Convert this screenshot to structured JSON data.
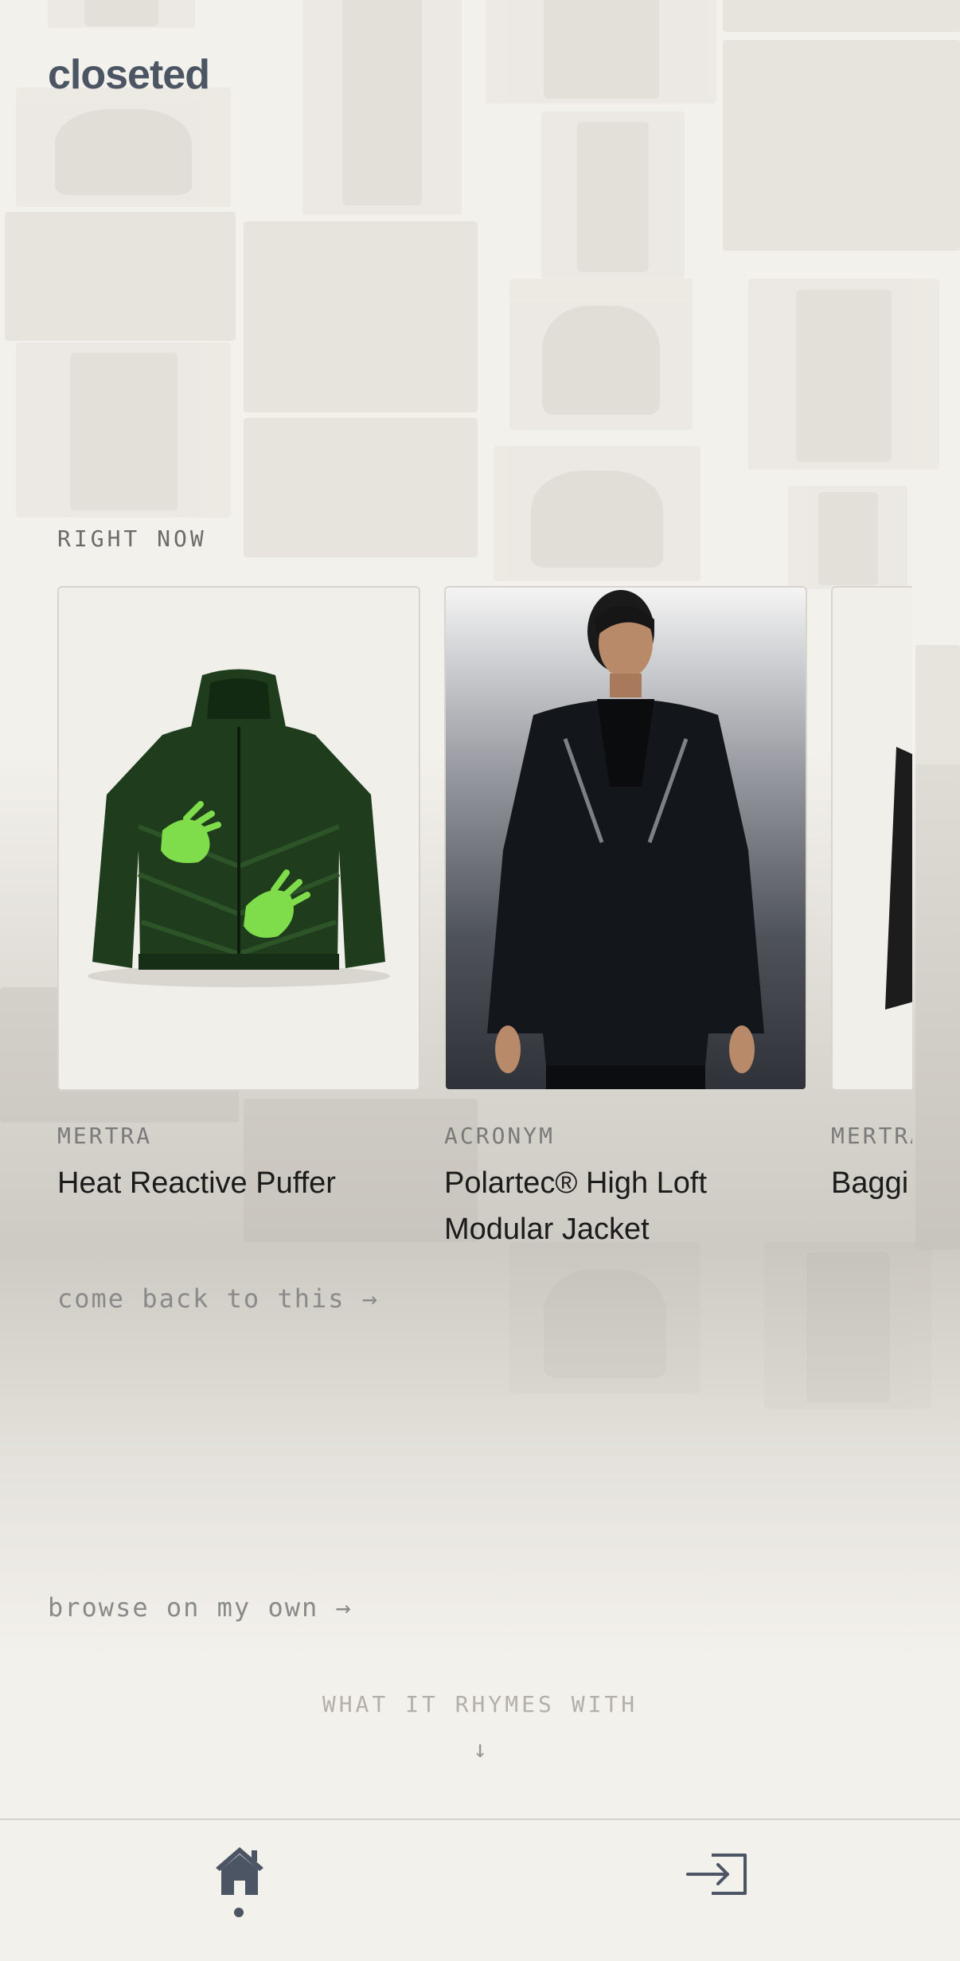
{
  "app": {
    "logo": "closeted"
  },
  "right_now": {
    "label": "RIGHT NOW",
    "items": [
      {
        "brand": "MERTRA",
        "name": "Heat Reactive Puffer"
      },
      {
        "brand": "ACRONYM",
        "name": "Polartec® High Loft Modular Jacket"
      },
      {
        "brand": "MERTRA",
        "name": "Baggi"
      }
    ],
    "come_back": "come back to this →"
  },
  "browse": {
    "label": "browse on my own →"
  },
  "rhymes": {
    "label": "WHAT IT RHYMES WITH",
    "arrow": "↓"
  },
  "tabbar": {
    "tabs": [
      {
        "icon": "home-icon",
        "active": true
      },
      {
        "icon": "login-icon",
        "active": false
      }
    ]
  },
  "colors": {
    "background": "#f3f1ec",
    "logo": "#4b5563",
    "muted_text": "#8a8a8a",
    "puffer_green": "#1f3d1c",
    "reactive_green": "#7fdc4a"
  }
}
